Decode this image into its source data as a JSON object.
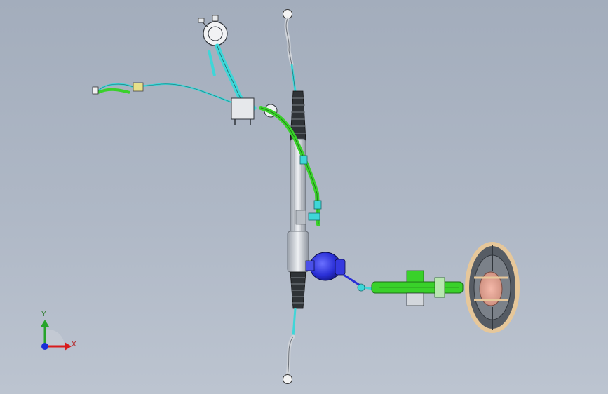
{
  "viewport": {
    "background_top": "#a3adbc",
    "background_bottom": "#bcc4d0"
  },
  "model": {
    "components": [
      "tie-rod-top",
      "tie-rod-bottom",
      "steering-rack",
      "rack-boot-upper",
      "rack-boot-lower",
      "fluid-reservoir",
      "pressure-hose",
      "return-hose",
      "pump-bracket",
      "steering-gear-valve",
      "intermediate-shaft",
      "steering-column",
      "steering-wheel"
    ],
    "colors": {
      "hose_green": "#39d12a",
      "hose_cyan": "#3fd6d8",
      "valve_blue": "#2a2fd6",
      "rack_silver": "#d7dbe2",
      "boot_dark": "#2f3337",
      "wheel_rim": "#e6c79a",
      "wheel_hub": "#e59a8a"
    }
  },
  "triad": {
    "x_label": "X",
    "y_label": "Y",
    "x_color": "#d81c1c",
    "y_color": "#27a42a",
    "origin_color": "#1b2fd8"
  }
}
